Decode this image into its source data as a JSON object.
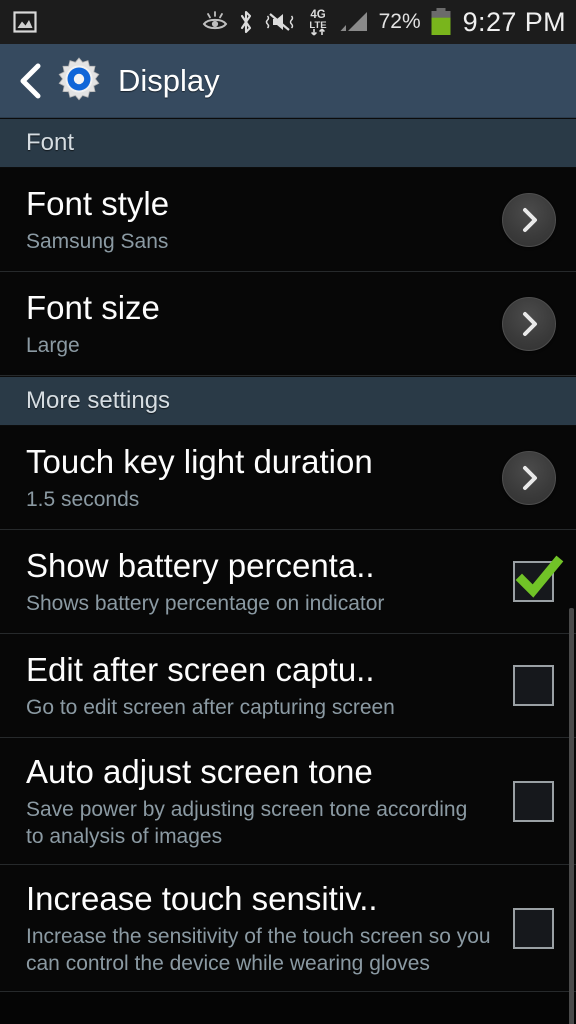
{
  "statusbar": {
    "notification_icon": "gallery-image-icon",
    "icons": [
      {
        "name": "smart-stay-eye-icon"
      },
      {
        "name": "bluetooth-icon"
      },
      {
        "name": "sound-muted-vibrate-icon"
      },
      {
        "name": "4g-lte-data-icon",
        "label_top": "4G",
        "label_bottom": "LTE"
      },
      {
        "name": "signal-bars-icon"
      }
    ],
    "battery_percent": "72%",
    "battery_level": 72,
    "battery_color": "#79b51c",
    "clock": "9:27 PM"
  },
  "actionbar": {
    "back_icon": "back-chevron-icon",
    "app_icon": "settings-gear-icon",
    "title": "Display",
    "background": "#364a5f"
  },
  "sections": [
    {
      "header": "Font",
      "items": [
        {
          "title": "Font style",
          "subtitle": "Samsung Sans",
          "control": "chevron",
          "name": "font-style"
        },
        {
          "title": "Font size",
          "subtitle": "Large",
          "control": "chevron",
          "name": "font-size"
        }
      ]
    },
    {
      "header": "More settings",
      "items": [
        {
          "title": "Touch key light duration",
          "subtitle": "1.5 seconds",
          "control": "chevron",
          "name": "touch-key-light-duration"
        },
        {
          "title": "Show battery percenta..",
          "subtitle": "Shows battery percentage on indicator",
          "control": "checkbox",
          "checked": true,
          "name": "show-battery-percentage"
        },
        {
          "title": "Edit after screen captu..",
          "subtitle": "Go to edit screen after capturing screen",
          "control": "checkbox",
          "checked": false,
          "name": "edit-after-screen-capture"
        },
        {
          "title": "Auto adjust screen tone",
          "subtitle": "Save power by adjusting screen tone according to analysis of images",
          "control": "checkbox",
          "checked": false,
          "name": "auto-adjust-screen-tone"
        },
        {
          "title": "Increase touch sensitiv..",
          "subtitle": "Increase the sensitivity of the touch screen so you can control the device while wearing gloves",
          "control": "checkbox",
          "checked": false,
          "name": "increase-touch-sensitivity"
        }
      ]
    }
  ],
  "colors": {
    "checkmark_green": "#71c327",
    "section_header_bg": "#2a3a47",
    "list_bg": "#070707",
    "subtitle": "#8b9aa3"
  }
}
